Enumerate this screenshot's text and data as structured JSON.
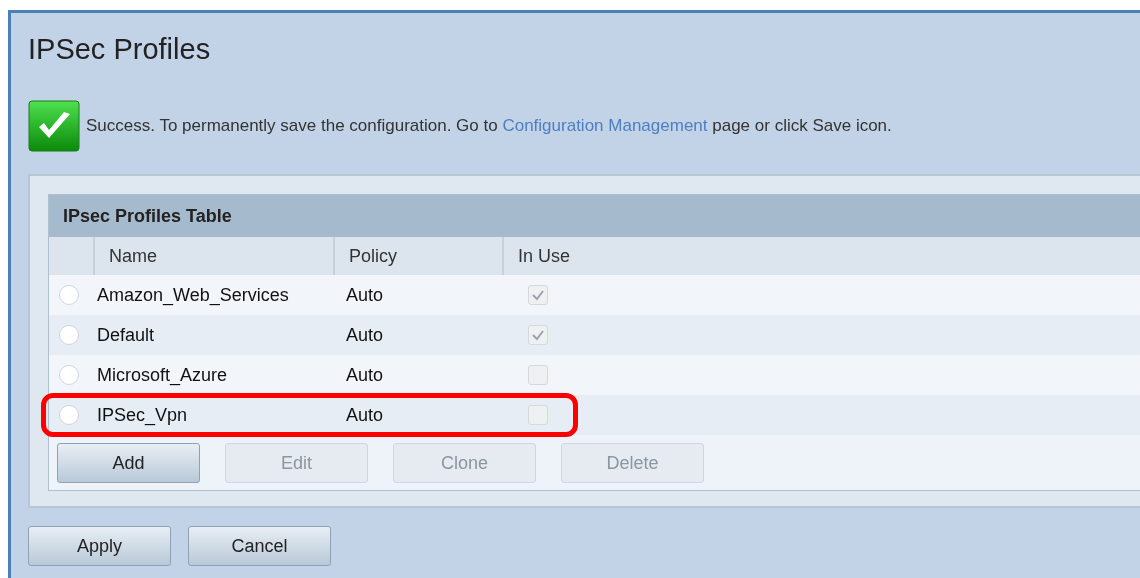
{
  "page": {
    "title": "IPSec Profiles"
  },
  "message": {
    "before": "Success. To permanently save the configuration. Go to",
    "link": "Configuration Management",
    "after": "page or click Save icon."
  },
  "table": {
    "title": "IPsec Profiles Table",
    "columns": [
      "Name",
      "Policy",
      "In Use"
    ],
    "rows": [
      {
        "name": "Amazon_Web_Services",
        "policy": "Auto",
        "in_use": true,
        "selected": false,
        "highlighted": false
      },
      {
        "name": "Default",
        "policy": "Auto",
        "in_use": true,
        "selected": false,
        "highlighted": false
      },
      {
        "name": "Microsoft_Azure",
        "policy": "Auto",
        "in_use": false,
        "selected": false,
        "highlighted": false
      },
      {
        "name": "IPSec_Vpn",
        "policy": "Auto",
        "in_use": false,
        "selected": false,
        "highlighted": true
      }
    ],
    "buttons": [
      {
        "label": "Add",
        "disabled": false
      },
      {
        "label": "Edit",
        "disabled": true
      },
      {
        "label": "Clone",
        "disabled": true
      },
      {
        "label": "Delete",
        "disabled": true
      }
    ]
  },
  "footer_buttons": [
    {
      "label": "Apply",
      "disabled": false
    },
    {
      "label": "Cancel",
      "disabled": false
    }
  ]
}
